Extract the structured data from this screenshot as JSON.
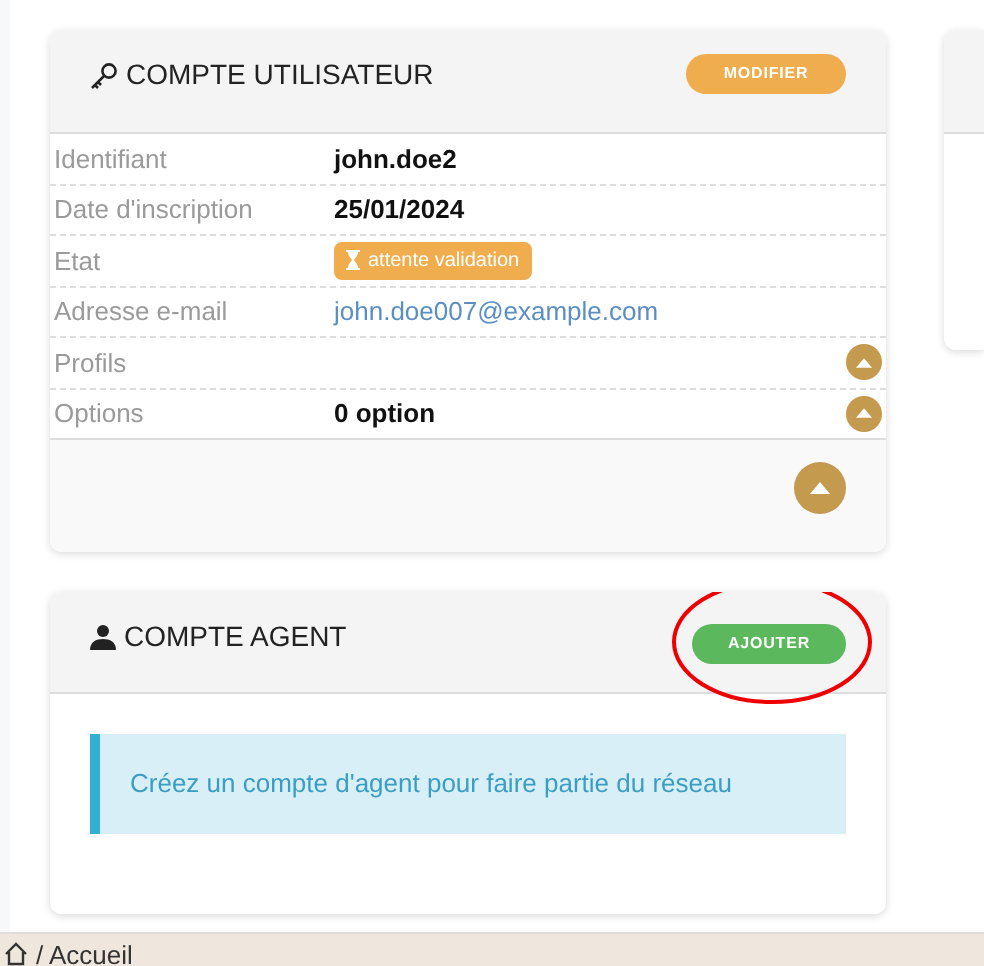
{
  "user_card": {
    "title": "COMPTE UTILISATEUR",
    "button": "MODIFIER",
    "rows": [
      {
        "label": "Identifiant",
        "kind": "text",
        "value": "john.doe2"
      },
      {
        "label": "Date d'inscription",
        "kind": "text",
        "value": "25/01/2024"
      },
      {
        "label": "Etat",
        "kind": "badge",
        "value": "attente validation"
      },
      {
        "label": "Adresse e-mail",
        "kind": "link",
        "value": "john.doe007@example.com"
      },
      {
        "label": "Profils",
        "kind": "toggle"
      },
      {
        "label": "Options",
        "kind": "toggle",
        "value": "0 option"
      }
    ]
  },
  "agent_card": {
    "title": "COMPTE AGENT",
    "button": "AJOUTER",
    "highlighted": true,
    "message": "Créez un compte d'agent pour faire partie du réseau"
  },
  "breadcrumb": {
    "path": "/ Accueil"
  }
}
